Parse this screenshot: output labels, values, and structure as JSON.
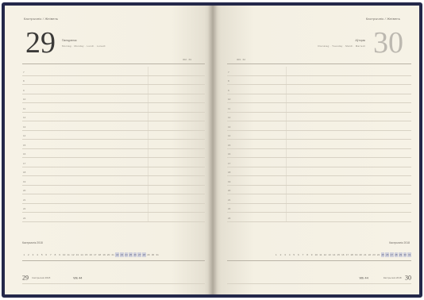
{
  "left_page": {
    "month": "Кастрычнік / Жнівень",
    "day_number": "29",
    "weekday": "Панядзелак",
    "weekday_translations": "Montag · Monday · Lundi · Lunedì",
    "day_counter": "302 · 63",
    "hours": [
      "7",
      "8",
      "9",
      "10",
      "11",
      "12",
      "13",
      "14",
      "15",
      "16",
      "17",
      "18",
      "19",
      "20",
      "21",
      "22",
      "23"
    ],
    "footer_month": "Кастрычнік 2018",
    "calendar_strip": [
      "1",
      "2",
      "3",
      "4",
      "5",
      "6",
      "7",
      "8",
      "9",
      "10",
      "11",
      "12",
      "13",
      "14",
      "15",
      "16",
      "17",
      "18",
      "19",
      "20",
      "21",
      "22",
      "23",
      "24",
      "25",
      "26",
      "27",
      "28",
      "29",
      "30",
      "31"
    ],
    "next_day_number": "29",
    "next_day_text": "Кастрычнік 2018",
    "week_label": "Wk 44"
  },
  "right_page": {
    "month": "Кастрычнік / Жнівень",
    "day_number": "30",
    "weekday": "Аўторак",
    "weekday_translations": "Dienstag · Tuesday · Mardi · Martedì",
    "day_counter": "303 · 62",
    "hours": [
      "7",
      "8",
      "9",
      "10",
      "11",
      "12",
      "13",
      "14",
      "15",
      "16",
      "17",
      "18",
      "19",
      "20",
      "21",
      "22",
      "23"
    ],
    "footer_month": "Кастрычнік 2018",
    "calendar_strip": [
      "1",
      "2",
      "3",
      "4",
      "5",
      "6",
      "7",
      "8",
      "9",
      "10",
      "11",
      "12",
      "13",
      "14",
      "15",
      "16",
      "17",
      "18",
      "19",
      "20",
      "21",
      "22",
      "23",
      "24",
      "25",
      "26",
      "27",
      "28",
      "29",
      "30",
      "31"
    ],
    "next_day_number": "30",
    "next_day_text": "Кастрычнік 2018",
    "week_label": "Wk 44"
  },
  "colors": {
    "cover": "#24284a",
    "paper": "#f6f2e6",
    "rule": "#d8d2c4",
    "highlight": "#cfd0dc"
  }
}
